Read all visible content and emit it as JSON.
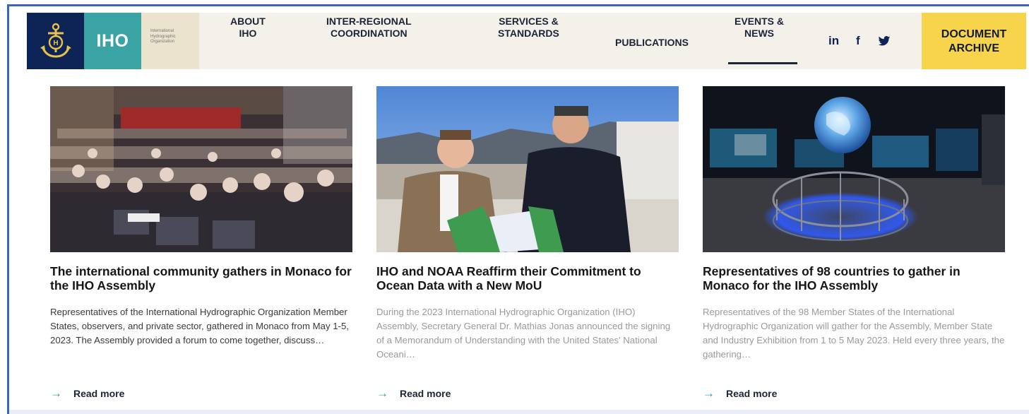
{
  "logo": {
    "abbr": "IHO",
    "org_lines": [
      "International",
      "Hydrographic",
      "Organization"
    ]
  },
  "nav": {
    "items": [
      {
        "line1": "ABOUT",
        "line2": "IHO"
      },
      {
        "line1": "INTER-REGIONAL",
        "line2": "COORDINATION"
      },
      {
        "line1": "SERVICES &",
        "line2": "STANDARDS"
      },
      {
        "line1": "PUBLICATIONS",
        "line2": ""
      },
      {
        "line1": "EVENTS &",
        "line2": "NEWS"
      }
    ],
    "social": [
      "in",
      "f"
    ],
    "cta": {
      "line1": "DOCUMENT",
      "line2": "ARCHIVE"
    }
  },
  "cards": [
    {
      "title": "The international community gathers in Monaco for the IHO Assembly",
      "text": "Representatives of the International Hydrographic Organization Member States, observers, and private sector, gathered in Monaco from May 1-5, 2023. The Assembly provided a forum to come together, discuss…",
      "read_more": "Read more"
    },
    {
      "title": "IHO and NOAA Reaffirm their Commitment to Ocean Data with a New MoU",
      "text": "During the 2023 International Hydrographic Organization (IHO) Assembly, Secretary General Dr. Mathias Jonas announced the signing of a Memorandum of Understanding with the United States' National Oceani…",
      "read_more": "Read more"
    },
    {
      "title": "Representatives of 98 countries to gather in Monaco for the IHO Assembly",
      "text": "Representatives of the 98 Member States of the International Hydrographic Organization will gather for the Assembly, Member State and Industry Exhibition from 1 to 5 May 2023. Held every three years, the gathering…",
      "read_more": "Read more"
    }
  ],
  "colors": {
    "navy": "#0f2456",
    "teal": "#3aa3a3",
    "accent_yellow": "#f7d44c",
    "nav_bg": "#f4f1ea",
    "text_dark": "#1b2537"
  }
}
